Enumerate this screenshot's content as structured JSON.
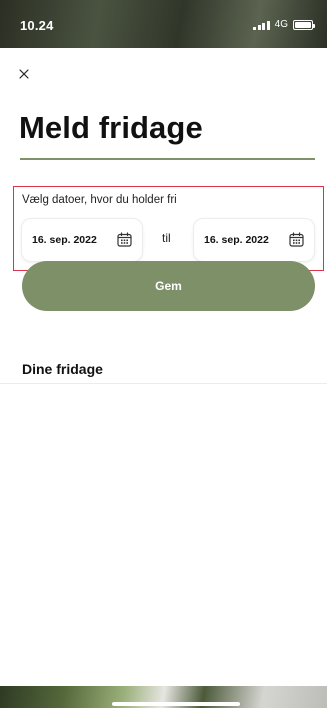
{
  "status_bar": {
    "time": "10.24",
    "network": "4G",
    "icons": [
      "signal-icon",
      "battery-icon"
    ]
  },
  "header": {
    "close_icon": "close-icon",
    "title": "Meld fridage"
  },
  "date_picker": {
    "label": "Vælg datoer, hvor du holder fri",
    "from_date": "16. sep. 2022",
    "separator": "til",
    "to_date": "16. sep. 2022",
    "icon": "calendar-icon"
  },
  "actions": {
    "save_label": "Gem"
  },
  "days_off": {
    "heading": "Dine fridage",
    "items": []
  },
  "colors": {
    "accent": "#7d9068",
    "highlight_border": "#d9354a",
    "rule": "#7e9169"
  }
}
